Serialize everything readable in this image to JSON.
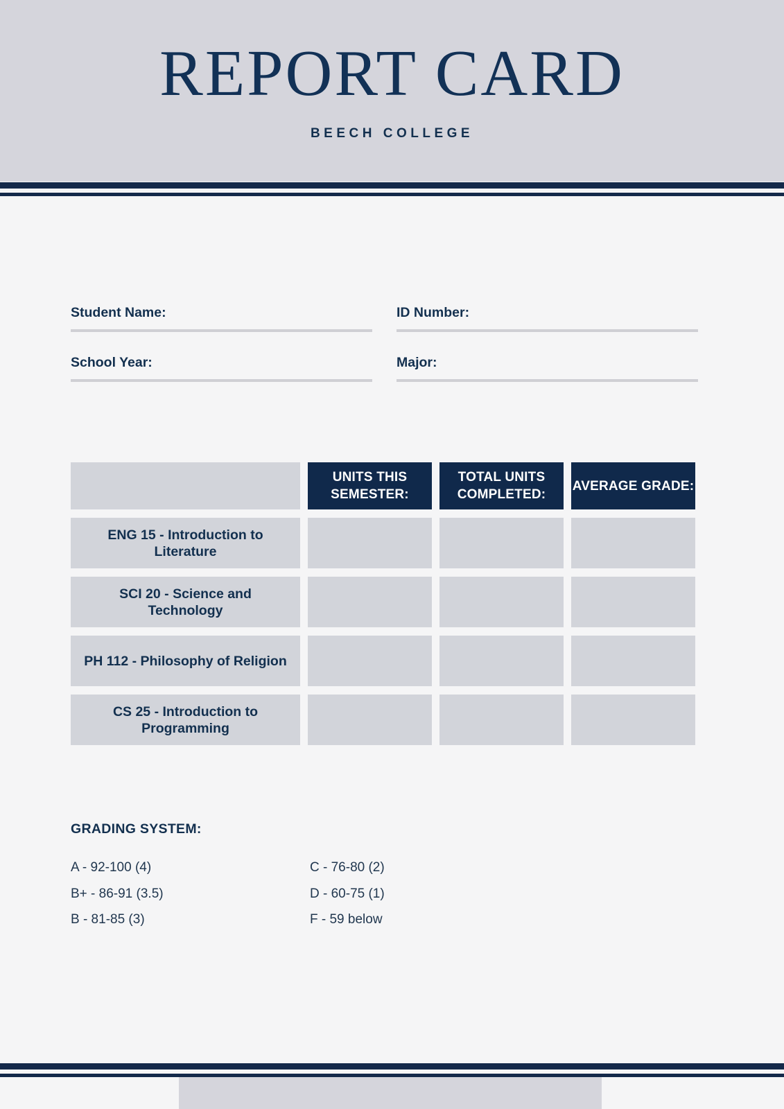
{
  "header": {
    "title": "REPORT CARD",
    "subtitle": "BEECH COLLEGE"
  },
  "colors": {
    "navy": "#10294b",
    "header_bg": "#d5d5dc",
    "page_bg": "#f5f5f6",
    "cell_gray": "#d2d4da",
    "field_line": "#cfcfd4"
  },
  "fields": [
    {
      "label": "Student Name:",
      "value": "",
      "placeholder": ""
    },
    {
      "label": "ID Number:",
      "value": "",
      "placeholder": ""
    },
    {
      "label": "School Year:",
      "value": "",
      "placeholder": ""
    },
    {
      "label": "Major:",
      "value": "",
      "placeholder": ""
    }
  ],
  "table": {
    "headers": {
      "course": "",
      "units_this_semester": "UNITS THIS SEMESTER:",
      "total_units_completed": "TOTAL UNITS COMPLETED:",
      "average_grade": "AVERAGE GRADE:"
    },
    "rows": [
      {
        "course": "ENG 15 - Introduction to Literature",
        "units_this_semester": "",
        "total_units_completed": "",
        "average_grade": ""
      },
      {
        "course": "SCI 20 - Science and Technology",
        "units_this_semester": "",
        "total_units_completed": "",
        "average_grade": ""
      },
      {
        "course": "PH 112 - Philosophy of Religion",
        "units_this_semester": "",
        "total_units_completed": "",
        "average_grade": ""
      },
      {
        "course": "CS 25 - Introduction to Programming",
        "units_this_semester": "",
        "total_units_completed": "",
        "average_grade": ""
      }
    ]
  },
  "grading": {
    "title": "GRADING SYSTEM:",
    "left": [
      "A - 92-100 (4)",
      "B+ - 86-91 (3.5)",
      "B - 81-85 (3)"
    ],
    "right": [
      "C - 76-80 (2)",
      "D - 60-75 (1)",
      "F - 59 below"
    ]
  }
}
